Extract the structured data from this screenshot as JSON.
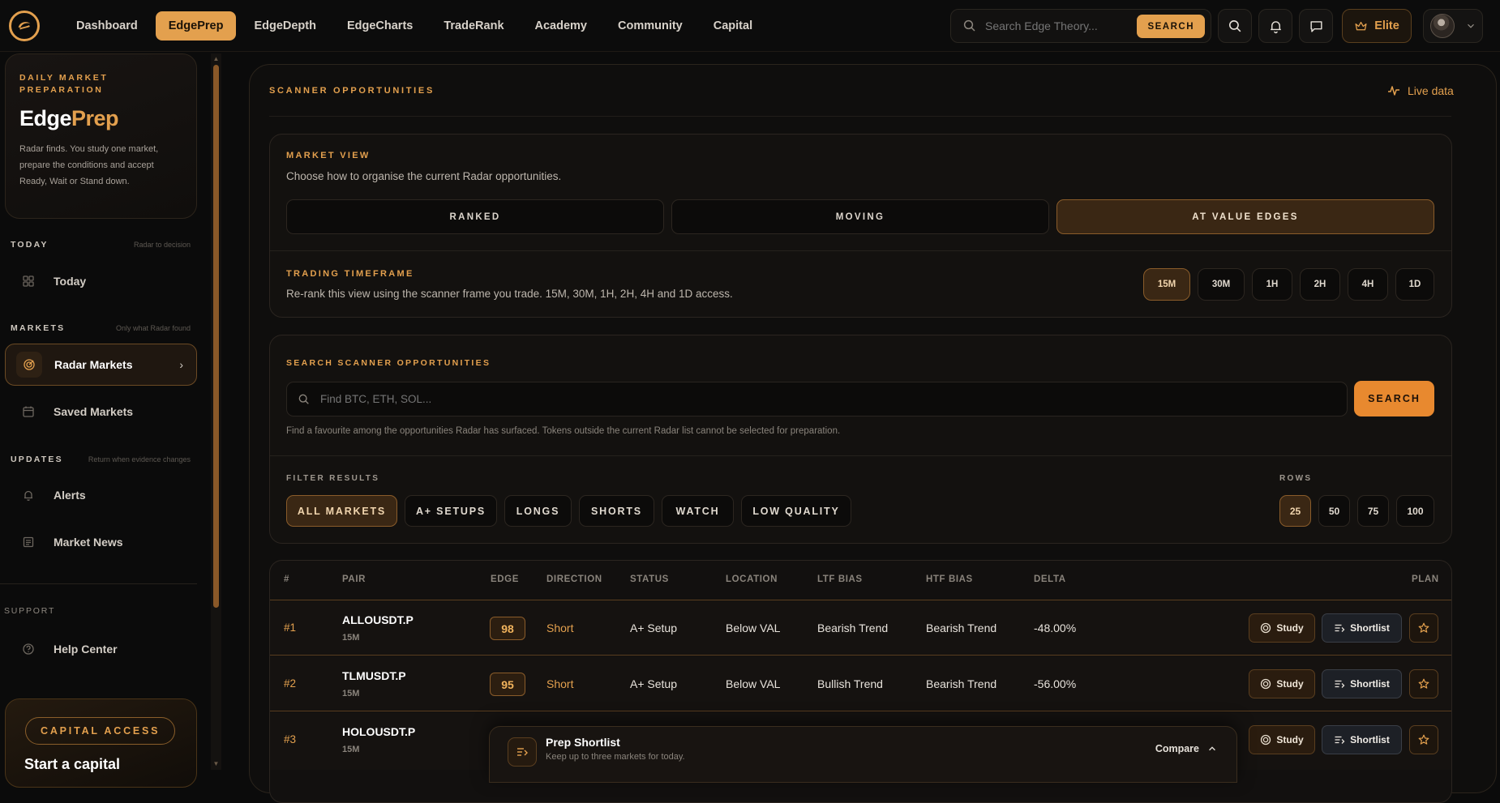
{
  "nav": {
    "items": [
      "Dashboard",
      "EdgePrep",
      "EdgeDepth",
      "EdgeCharts",
      "TradeRank",
      "Academy",
      "Community",
      "Capital"
    ],
    "active_index": 1,
    "search_placeholder": "Search Edge Theory...",
    "search_button": "SEARCH",
    "elite_label": "Elite"
  },
  "sidebar": {
    "card": {
      "eyebrow": "DAILY MARKET PREPARATION",
      "brand_white": "Edge",
      "brand_orange": "Prep",
      "description": "Radar finds. You study one market, prepare the conditions and accept Ready, Wait or Stand down."
    },
    "today": {
      "heading": "TODAY",
      "hint": "Radar to decision",
      "items": [
        "Today"
      ]
    },
    "markets": {
      "heading": "MARKETS",
      "hint": "Only what Radar found",
      "items": [
        "Radar Markets",
        "Saved Markets"
      ]
    },
    "updates": {
      "heading": "UPDATES",
      "hint": "Return when evidence changes",
      "items": [
        "Alerts",
        "Market News"
      ]
    },
    "support": {
      "heading": "SUPPORT",
      "items": [
        "Help Center"
      ]
    },
    "capital": {
      "badge": "CAPITAL ACCESS",
      "title": "Start a capital"
    }
  },
  "panel": {
    "title": "SCANNER OPPORTUNITIES",
    "live_label": "Live data",
    "market_view": {
      "eyebrow": "MARKET VIEW",
      "description": "Choose how to organise the current Radar opportunities.",
      "options": [
        "RANKED",
        "MOVING",
        "AT VALUE EDGES"
      ],
      "active_index": 2
    },
    "timeframe": {
      "eyebrow": "TRADING TIMEFRAME",
      "description": "Re-rank this view using the scanner frame you trade. 15M, 30M, 1H, 2H, 4H and 1D access.",
      "options": [
        "15M",
        "30M",
        "1H",
        "2H",
        "4H",
        "1D"
      ],
      "active_index": 0
    },
    "search": {
      "eyebrow": "SEARCH SCANNER OPPORTUNITIES",
      "placeholder": "Find BTC, ETH, SOL...",
      "button": "SEARCH",
      "hint": "Find a favourite among the opportunities Radar has surfaced. Tokens outside the current Radar list cannot be selected for preparation."
    },
    "filters": {
      "eyebrow": "FILTER RESULTS",
      "options": [
        "ALL MARKETS",
        "A+ SETUPS",
        "LONGS",
        "SHORTS",
        "WATCH",
        "LOW QUALITY"
      ],
      "active_index": 0
    },
    "rows": {
      "eyebrow": "ROWS",
      "options": [
        "25",
        "50",
        "75",
        "100"
      ],
      "active_index": 0
    }
  },
  "table": {
    "headers": [
      "#",
      "PAIR",
      "EDGE",
      "DIRECTION",
      "STATUS",
      "LOCATION",
      "LTF BIAS",
      "HTF BIAS",
      "DELTA",
      "PLAN"
    ],
    "study_label": "Study",
    "shortlist_label": "Shortlist",
    "rows": [
      {
        "rank": "#1",
        "pair": "ALLOUSDT.P",
        "tf": "15M",
        "edge": "98",
        "direction": "Short",
        "status": "A+ Setup",
        "location": "Below VAL",
        "ltf": "Bearish Trend",
        "htf": "Bearish Trend",
        "delta": "-48.00%"
      },
      {
        "rank": "#2",
        "pair": "TLMUSDT.P",
        "tf": "15M",
        "edge": "95",
        "direction": "Short",
        "status": "A+ Setup",
        "location": "Below VAL",
        "ltf": "Bullish Trend",
        "htf": "Bearish Trend",
        "delta": "-56.00%"
      },
      {
        "rank": "#3",
        "pair": "HOLOUSDT.P",
        "tf": "15M"
      }
    ]
  },
  "prep_bar": {
    "title": "Prep Shortlist",
    "subtitle": "Keep up to three markets for today.",
    "compare": "Compare"
  },
  "colors": {
    "accent": "#e3a04e",
    "search_button": "#e8892f",
    "background": "#0b0b0b"
  }
}
